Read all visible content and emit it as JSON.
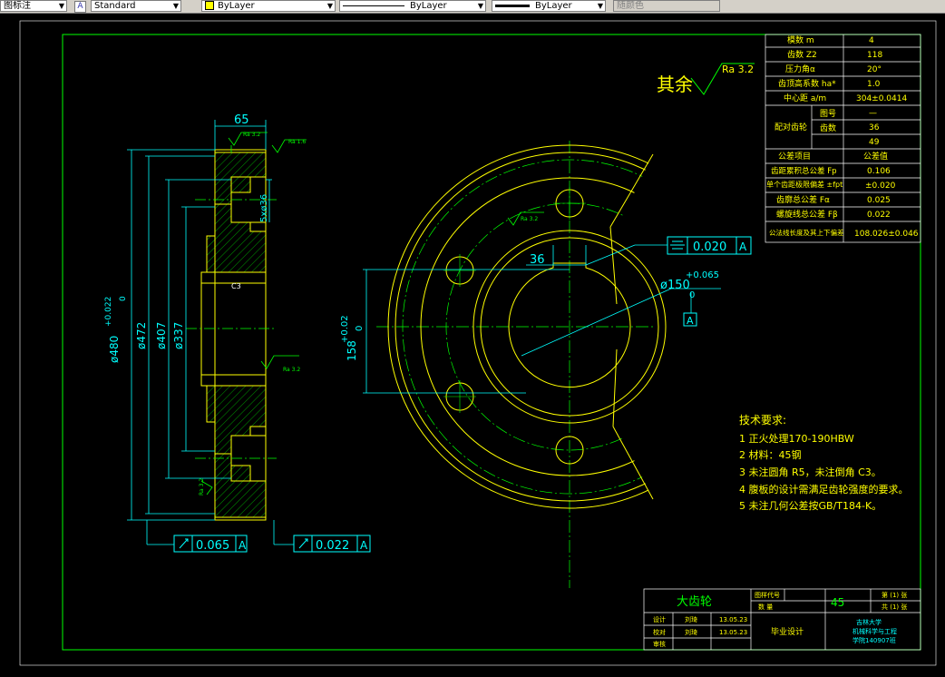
{
  "toolbar": {
    "dimstyle_label": "图标注",
    "textstyle_value": "Standard",
    "color_value": "ByLayer",
    "linetype_value": "ByLayer",
    "lineweight_value": "ByLayer",
    "plotstyle_value": "随颜色",
    "color_swatch": "#ffff00"
  },
  "colors": {
    "border": "#00ff00",
    "dimension": "#00ffff",
    "outline": "#ffff00",
    "center": "#00ff00",
    "text": "#ffffff",
    "hatch": "#00ff00"
  },
  "drawing": {
    "other_roughness_label": "其余",
    "other_roughness_value": "Ra 3.2",
    "side_width_dim": "65",
    "side_chamfer": "C3",
    "side_hole_dim": "5xø36",
    "side_diam_main": "ø480",
    "side_diam_tol_upper": "+0.022",
    "side_diam_tol_lower": "0",
    "side_diam_472": "ø472",
    "side_diam_407": "ø407",
    "side_diam_337": "ø337",
    "ra_16": "Ra 1.6",
    "ra_32": "Ra 3.2",
    "ra_32b": "Ra 3.2",
    "ra_32c": "Ra 3.2",
    "ra_32d": "Ra 3.2",
    "fc_left_value": "0.065",
    "fc_left_datum": "A",
    "fc_right_value": "0.022",
    "fc_right_datum": "A",
    "fc_sym_value": "0.020",
    "fc_sym_datum": "A",
    "keyway_width": "36",
    "bore_dim": "ø150",
    "bore_tol_upper": "+0.065",
    "bore_tol_lower": "0",
    "keyway_depth": "158",
    "keyway_tol_upper": "+0.02",
    "keyway_tol_lower": "0",
    "datum_label": "A"
  },
  "param_table": [
    {
      "label": "模数 m",
      "value": "4"
    },
    {
      "label": "齿数 Z2",
      "value": "118"
    },
    {
      "label": "压力角α",
      "value": "20°"
    },
    {
      "label": "齿顶高系数 ha*",
      "value": "1.0"
    },
    {
      "label": "中心距 a/m",
      "value": "304±0.0414"
    },
    {
      "label": "图号",
      "value": "—"
    },
    {
      "label": "齿数",
      "value": "36"
    },
    {
      "label": "",
      "value": "49"
    },
    {
      "label": "公差项目",
      "value": "公差值"
    },
    {
      "label": "齿距累积总公差 Fp",
      "value": "0.106"
    },
    {
      "label": "单个齿距极限偏差 ±fpt",
      "value": "±0.020"
    },
    {
      "label": "齿廓总公差 Fα",
      "value": "0.025"
    },
    {
      "label": "螺旋线总公差 Fβ",
      "value": "0.022"
    },
    {
      "label": "公法线长度及其上下偏差",
      "value": "108.026±0.046"
    }
  ],
  "param_group_label": "配对齿轮",
  "tech_req": {
    "title": "技术要求:",
    "lines": [
      "1 正火处理170-190HBW",
      "2 材料：45钢",
      "3 未注圆角 R5，未注倒角 C3。",
      "4 腹板的设计需满足齿轮强度的要求。",
      "5 未注几何公差按GB/T184-K。"
    ]
  },
  "title_block": {
    "part_name": "大齿轮",
    "material": "45",
    "drawing_no_label": "图样代号",
    "count_label": "数 量",
    "sheet_total": "共 (1) 张",
    "sheet_no": "第 (1) 张",
    "design_label": "设计",
    "check_label": "校对",
    "review_label": "审核",
    "designer": "刘琦",
    "checker": "刘琦",
    "date1": "13.05.23",
    "date2": "13.05.23",
    "project": "毕业设计",
    "school_1": "吉林大学",
    "school_2": "机械科学与工程",
    "school_3": "学院140907班"
  }
}
